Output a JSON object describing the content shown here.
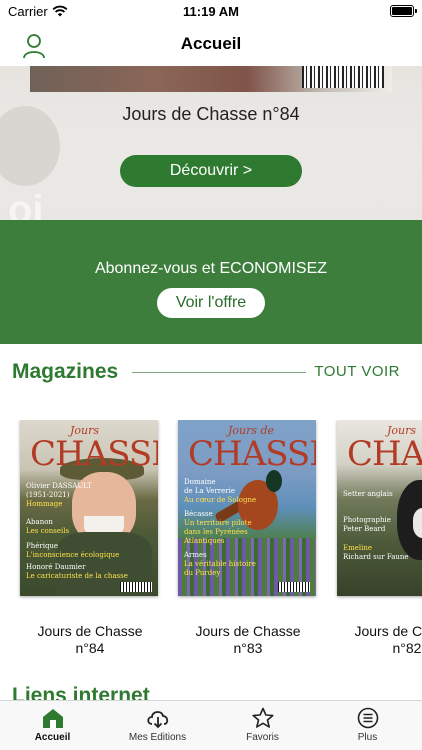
{
  "status_bar": {
    "carrier": "Carrier",
    "time": "11:19 AM"
  },
  "nav": {
    "title": "Accueil"
  },
  "hero": {
    "title": "Jours de Chasse n°84",
    "ghost_text": "oi",
    "button_label": "Découvrir >"
  },
  "subscribe": {
    "text": "Abonnez-vous et ECONOMISEZ",
    "button_label": "Voir l'offre"
  },
  "magazines_section": {
    "title": "Magazines",
    "see_all_label": "TOUT VOIR"
  },
  "magazines": [
    {
      "line1": "Jours de Chasse",
      "line2": "n°84",
      "cover": {
        "masthead": "CHASSE",
        "sub": "Jours",
        "lines": [
          "Olivier DASSAULT",
          "(1951-2021)",
          "Hommage",
          "Abanon",
          "Les conseils",
          "Phérique",
          "L'inconscience écologique",
          "Honoré Daumier",
          "Le caricaturiste de la chasse"
        ]
      }
    },
    {
      "line1": "Jours de Chasse",
      "line2": "n°83",
      "cover": {
        "masthead": "CHASSE",
        "sub": "Jours de",
        "lines": [
          "Domaine",
          "de La Verrerie",
          "Au cœur de Sologne",
          "Bécasse",
          "Un territoire pilote",
          "dans les Pyrénées",
          "Atlantiques",
          "Armes",
          "La véritable histoire",
          "du Purdey"
        ]
      }
    },
    {
      "line1": "Jours de Chasse",
      "line2": "n°82",
      "cover": {
        "masthead": "CHASSE",
        "sub": "Jours",
        "lines": [
          "Setter anglais",
          "Photographie",
          "Peter Beard",
          "Emeline",
          "Richard sur Faune"
        ]
      }
    }
  ],
  "links_section": {
    "title": "Liens internet"
  },
  "tab_bar": {
    "tabs": [
      {
        "label": "Accueil",
        "icon": "home-icon",
        "active": true
      },
      {
        "label": "Mes Editions",
        "icon": "download-cloud-icon",
        "active": false
      },
      {
        "label": "Favoris",
        "icon": "star-icon",
        "active": false
      },
      {
        "label": "Plus",
        "icon": "more-icon",
        "active": false
      }
    ]
  },
  "colors": {
    "brand_green": "#2f7a31",
    "banner_green": "#3d7e3d"
  }
}
